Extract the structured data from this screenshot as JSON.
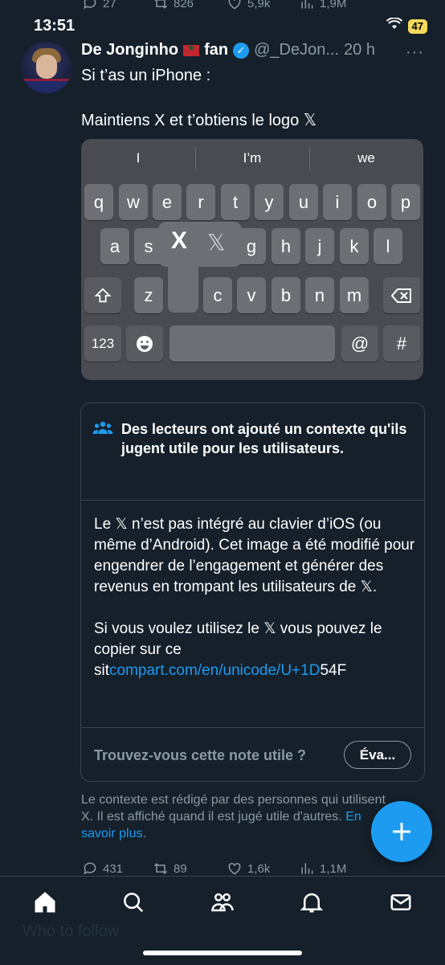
{
  "status_bar": {
    "time": "13:51",
    "battery": "47"
  },
  "top_stats": {
    "replies": "27",
    "retweets": "826",
    "likes": "5,9k",
    "views": "1,9M"
  },
  "tweet": {
    "author_name": "De Jonginho",
    "author_suffix": "fan",
    "handle": "@_DeJon...",
    "time": "20 h",
    "more": "···",
    "line1": "Si t’as un iPhone :",
    "line2": "Maintiens X et t’obtiens le logo 𝕏"
  },
  "keyboard": {
    "suggestions": [
      "I",
      "I’m",
      "we"
    ],
    "row1": [
      "q",
      "w",
      "e",
      "r",
      "t",
      "y",
      "u",
      "i",
      "o",
      "p"
    ],
    "row2": [
      "a",
      "s",
      "g",
      "h",
      "j",
      "k",
      "l"
    ],
    "row3": [
      "z",
      "c",
      "v",
      "b",
      "n",
      "m"
    ],
    "popup": [
      "X",
      "𝕏"
    ],
    "numbers_key": "123",
    "at_key": "@",
    "hash_key": "#"
  },
  "community_note": {
    "header": "Des lecteurs ont ajouté un contexte qu'ils jugent utile pour les utilisateurs.",
    "p1": "Le 𝕏 n’est pas intégré au clavier d’iOS (ou même d’Android). Cet image a été modifié pour engendrer de l’engagement et générer des revenus en trompant les utilisateurs de 𝕏.",
    "p2_start": "Si vous voulez utilisez le 𝕏 vous pouvez le copier sur ce sit",
    "p2_link": "compart.com/en/unicode/U+1D",
    "p2_end": "54F",
    "rate_question": "Trouvez-vous cette note utile ?",
    "rate_button": "Éva..."
  },
  "context_footer": {
    "text": "Le contexte est rédigé par des personnes qui utilisent X. Il est affiché quand il est jugé utile d'autres.",
    "link": "En savoir plus",
    "end": "."
  },
  "bottom_stats": {
    "replies": "431",
    "retweets": "89",
    "likes": "1,6k",
    "views": "1,1M"
  },
  "faded_text": "Who to follow",
  "colors": {
    "background": "#15202b",
    "accent": "#1d9bf0",
    "muted": "#8b98a5",
    "border": "#38444d"
  }
}
